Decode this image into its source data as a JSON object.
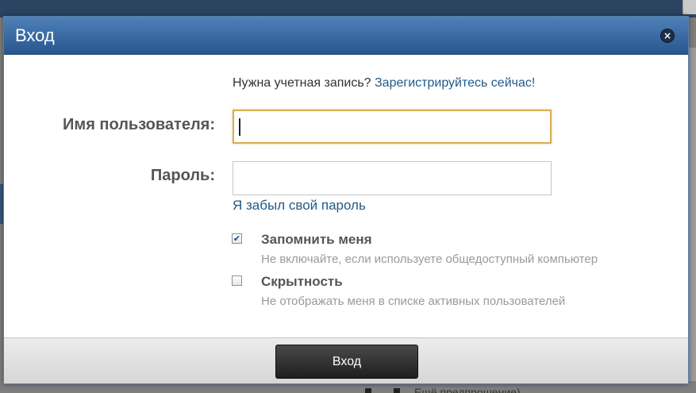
{
  "dialog": {
    "title": "Вход",
    "close_icon": "close-icon"
  },
  "signup": {
    "prompt": "Нужна учетная запись?",
    "link": "Зарегистрируйтесь сейчас!"
  },
  "form": {
    "username_label": "Имя пользователя:",
    "username_value": "",
    "password_label": "Пароль:",
    "password_value": "",
    "forgot_link": "Я забыл свой пароль"
  },
  "options": [
    {
      "title": "Запомнить меня",
      "description": "Не включайте, если используете общедоступный компьютер",
      "checked": true
    },
    {
      "title": "Скрытность",
      "description": "Не отображать меня в списке активных пользователей",
      "checked": false
    }
  ],
  "footer": {
    "submit_label": "Вход"
  },
  "background": {
    "partial_text": "Ещё предпрошение)"
  },
  "colors": {
    "titlebar": "#3567a0",
    "link": "#1f5a8a",
    "focus_border": "#d9ad55",
    "button": "#2c2c2c"
  }
}
